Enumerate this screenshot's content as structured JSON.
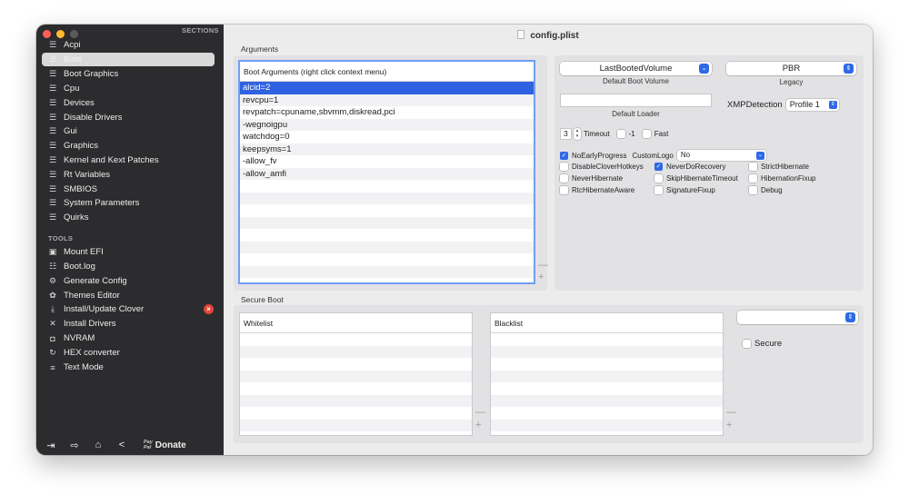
{
  "window": {
    "title": "config.plist"
  },
  "sidebar": {
    "sections_heading": "SECTIONS",
    "sections": [
      {
        "label": "Acpi",
        "icon": "list-icon"
      },
      {
        "label": "Boot",
        "icon": "list-icon",
        "active": true
      },
      {
        "label": "Boot Graphics",
        "icon": "list-icon"
      },
      {
        "label": "Cpu",
        "icon": "list-icon"
      },
      {
        "label": "Devices",
        "icon": "list-icon"
      },
      {
        "label": "Disable Drivers",
        "icon": "list-icon"
      },
      {
        "label": "Gui",
        "icon": "list-icon"
      },
      {
        "label": "Graphics",
        "icon": "list-icon"
      },
      {
        "label": "Kernel and Kext Patches",
        "icon": "list-icon"
      },
      {
        "label": "Rt Variables",
        "icon": "list-icon"
      },
      {
        "label": "SMBIOS",
        "icon": "list-icon"
      },
      {
        "label": "System Parameters",
        "icon": "list-icon"
      },
      {
        "label": "Quirks",
        "icon": "list-icon"
      }
    ],
    "tools_heading": "TOOLS",
    "tools": [
      {
        "label": "Mount EFI",
        "icon": "disk-icon"
      },
      {
        "label": "Boot.log",
        "icon": "log-search-icon"
      },
      {
        "label": "Generate Config",
        "icon": "gears-icon"
      },
      {
        "label": "Themes Editor",
        "icon": "palette-icon"
      },
      {
        "label": "Install/Update Clover",
        "icon": "download-icon",
        "badge": "x"
      },
      {
        "label": "Install Drivers",
        "icon": "tools-icon"
      },
      {
        "label": "NVRAM",
        "icon": "chip-icon"
      },
      {
        "label": "HEX converter",
        "icon": "convert-icon"
      },
      {
        "label": "Text Mode",
        "icon": "text-lines-icon"
      }
    ],
    "bottom": {
      "donate_label": "Donate",
      "paypal_text_1": "Pay",
      "paypal_text_2": "Pal"
    }
  },
  "arguments": {
    "group_label": "Arguments",
    "header": "Boot Arguments (right click context menu)",
    "items": [
      "alcid=2",
      "revcpu=1",
      "revpatch=cpuname,sbvmm,diskread,pci",
      "-wegnoigpu",
      "watchdog=0",
      "keepsyms=1",
      "-allow_fv",
      "-allow_amfi"
    ],
    "selected_index": 0,
    "minus": "—",
    "plus": "+"
  },
  "boot": {
    "default_volume": {
      "value": "LastBootedVolume",
      "label": "Default Boot Volume"
    },
    "legacy": {
      "value": "PBR",
      "label": "Legacy"
    },
    "default_loader": {
      "value": "",
      "label": "Default Loader"
    },
    "xmp": {
      "label": "XMPDetection",
      "value": "Profile 1"
    },
    "timeout": {
      "value": "3",
      "label": "Timeout"
    },
    "minus_one": {
      "label": "-1",
      "checked": false
    },
    "fast": {
      "label": "Fast",
      "checked": false
    },
    "custom_logo": {
      "label": "CustomLogo",
      "value": "No"
    },
    "checkboxes": [
      {
        "label": "NoEarlyProgress",
        "checked": true
      },
      {
        "label": "DisableCloverHotkeys",
        "checked": false
      },
      {
        "label": "NeverDoRecovery",
        "checked": true
      },
      {
        "label": "StrictHibernate",
        "checked": false
      },
      {
        "label": "NeverHibernate",
        "checked": false
      },
      {
        "label": "SkipHibernateTimeout",
        "checked": false
      },
      {
        "label": "HibernationFixup",
        "checked": false
      },
      {
        "label": "RtcHibernateAware",
        "checked": false
      },
      {
        "label": "SignatureFixup",
        "checked": false
      },
      {
        "label": "Debug",
        "checked": false
      }
    ]
  },
  "secure_boot": {
    "group_label": "Secure Boot",
    "whitelist_header": "Whitelist",
    "blacklist_header": "Blacklist",
    "policy_value": "",
    "secure": {
      "label": "Secure",
      "checked": false
    },
    "minus": "—",
    "plus": "+"
  },
  "colors": {
    "accent": "#2f6ae6",
    "selection": "#2f62e0",
    "sidebar_bg": "#2c2c2e",
    "badge": "#e0443a"
  }
}
